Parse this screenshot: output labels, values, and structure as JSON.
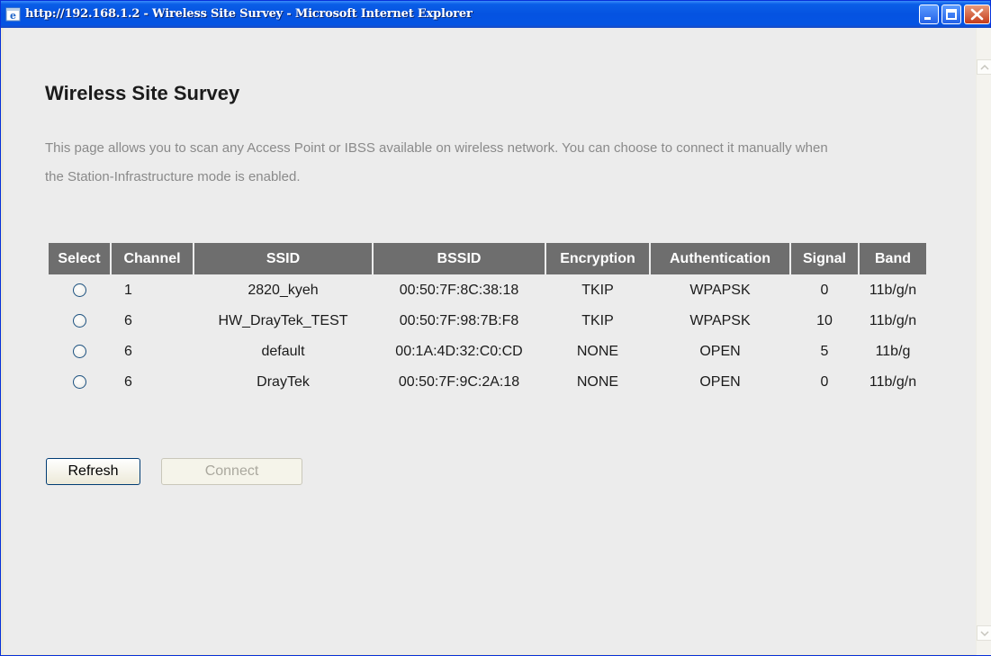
{
  "window": {
    "title": "http://192.168.1.2 - Wireless Site Survey - Microsoft Internet Explorer"
  },
  "page": {
    "title": "Wireless Site Survey",
    "description": "This page allows you to scan any Access Point or IBSS available on wireless network. You can choose to connect it manually when the Station-Infrastructure mode is enabled."
  },
  "table": {
    "headers": [
      "Select",
      "Channel",
      "SSID",
      "BSSID",
      "Encryption",
      "Authentication",
      "Signal",
      "Band"
    ],
    "rows": [
      {
        "selected": false,
        "channel": "1",
        "ssid": "2820_kyeh",
        "bssid": "00:50:7F:8C:38:18",
        "encryption": "TKIP",
        "authentication": "WPAPSK",
        "signal": "0",
        "band": "11b/g/n"
      },
      {
        "selected": false,
        "channel": "6",
        "ssid": "HW_DrayTek_TEST",
        "bssid": "00:50:7F:98:7B:F8",
        "encryption": "TKIP",
        "authentication": "WPAPSK",
        "signal": "10",
        "band": "11b/g/n"
      },
      {
        "selected": false,
        "channel": "6",
        "ssid": "default",
        "bssid": "00:1A:4D:32:C0:CD",
        "encryption": "NONE",
        "authentication": "OPEN",
        "signal": "5",
        "band": "11b/g"
      },
      {
        "selected": false,
        "channel": "6",
        "ssid": "DrayTek",
        "bssid": "00:50:7F:9C:2A:18",
        "encryption": "NONE",
        "authentication": "OPEN",
        "signal": "0",
        "band": "11b/g/n"
      }
    ]
  },
  "buttons": {
    "refresh": "Refresh",
    "connect": "Connect"
  },
  "icons": {
    "app": "ie-icon",
    "minimize": "minimize-icon",
    "maximize": "maximize-icon",
    "close": "close-icon",
    "scroll_up": "scroll-up-arrow-icon",
    "scroll_down": "scroll-down-arrow-icon"
  },
  "colors": {
    "titlebar": "#0553e1",
    "table_header": "#6e6e6e",
    "description_text": "#8a8a8a",
    "close_button": "#c53c1a"
  }
}
